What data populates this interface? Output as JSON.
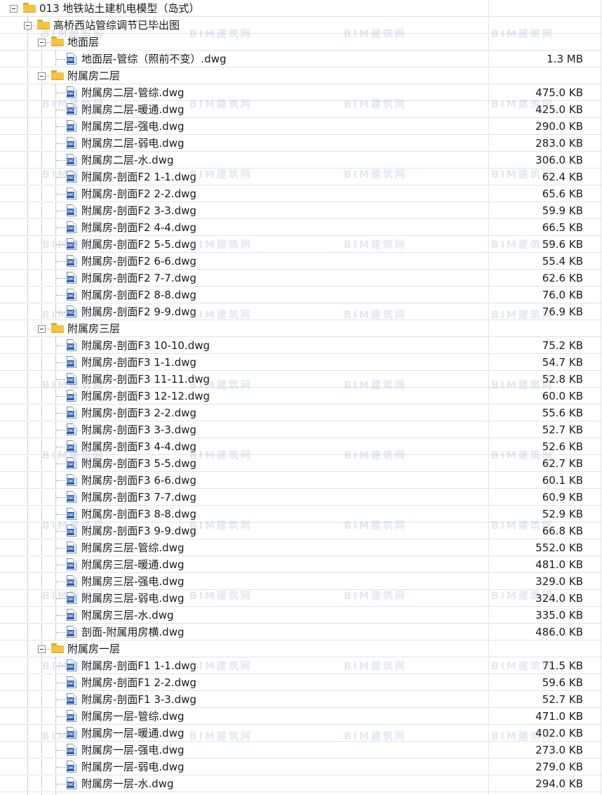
{
  "watermark": "BIM建筑网",
  "rows": [
    {
      "type": "folder",
      "level": 0,
      "label": "013 地铁站土建机电模型（岛式）",
      "size": ""
    },
    {
      "type": "folder",
      "level": 1,
      "label": "高桥西站管综调节已毕出图",
      "size": ""
    },
    {
      "type": "folder",
      "level": 2,
      "label": "地面层",
      "size": ""
    },
    {
      "type": "file",
      "level": 3,
      "label": "地面层-管综（照前不变）.dwg",
      "size": "1.3 MB"
    },
    {
      "type": "folder",
      "level": 2,
      "label": "附属房二层",
      "size": ""
    },
    {
      "type": "file",
      "level": 3,
      "label": "附属房二层-管综.dwg",
      "size": "475.0 KB"
    },
    {
      "type": "file",
      "level": 3,
      "label": "附属房二层-暖通.dwg",
      "size": "425.0 KB"
    },
    {
      "type": "file",
      "level": 3,
      "label": "附属房二层-强电.dwg",
      "size": "290.0 KB"
    },
    {
      "type": "file",
      "level": 3,
      "label": "附属房二层-弱电.dwg",
      "size": "283.0 KB"
    },
    {
      "type": "file",
      "level": 3,
      "label": "附属房二层-水.dwg",
      "size": "306.0 KB"
    },
    {
      "type": "file",
      "level": 3,
      "label": "附属房-剖面F2 1-1.dwg",
      "size": "62.4 KB"
    },
    {
      "type": "file",
      "level": 3,
      "label": "附属房-剖面F2 2-2.dwg",
      "size": "65.6 KB"
    },
    {
      "type": "file",
      "level": 3,
      "label": "附属房-剖面F2 3-3.dwg",
      "size": "59.9 KB"
    },
    {
      "type": "file",
      "level": 3,
      "label": "附属房-剖面F2 4-4.dwg",
      "size": "66.5 KB"
    },
    {
      "type": "file",
      "level": 3,
      "label": "附属房-剖面F2 5-5.dwg",
      "size": "59.6 KB"
    },
    {
      "type": "file",
      "level": 3,
      "label": "附属房-剖面F2 6-6.dwg",
      "size": "55.4 KB"
    },
    {
      "type": "file",
      "level": 3,
      "label": "附属房-剖面F2 7-7.dwg",
      "size": "62.6 KB"
    },
    {
      "type": "file",
      "level": 3,
      "label": "附属房-剖面F2 8-8.dwg",
      "size": "76.0 KB"
    },
    {
      "type": "file",
      "level": 3,
      "label": "附属房-剖面F2 9-9.dwg",
      "size": "76.9 KB"
    },
    {
      "type": "folder",
      "level": 2,
      "label": "附属房三层",
      "size": ""
    },
    {
      "type": "file",
      "level": 3,
      "label": "附属房-剖面F3 10-10.dwg",
      "size": "75.2 KB"
    },
    {
      "type": "file",
      "level": 3,
      "label": "附属房-剖面F3 1-1.dwg",
      "size": "54.7 KB"
    },
    {
      "type": "file",
      "level": 3,
      "label": "附属房-剖面F3 11-11.dwg",
      "size": "52.8 KB"
    },
    {
      "type": "file",
      "level": 3,
      "label": "附属房-剖面F3 12-12.dwg",
      "size": "60.0 KB"
    },
    {
      "type": "file",
      "level": 3,
      "label": "附属房-剖面F3 2-2.dwg",
      "size": "55.6 KB"
    },
    {
      "type": "file",
      "level": 3,
      "label": "附属房-剖面F3 3-3.dwg",
      "size": "52.7 KB"
    },
    {
      "type": "file",
      "level": 3,
      "label": "附属房-剖面F3 4-4.dwg",
      "size": "52.6 KB"
    },
    {
      "type": "file",
      "level": 3,
      "label": "附属房-剖面F3 5-5.dwg",
      "size": "62.7 KB"
    },
    {
      "type": "file",
      "level": 3,
      "label": "附属房-剖面F3 6-6.dwg",
      "size": "60.1 KB"
    },
    {
      "type": "file",
      "level": 3,
      "label": "附属房-剖面F3 7-7.dwg",
      "size": "60.9 KB"
    },
    {
      "type": "file",
      "level": 3,
      "label": "附属房-剖面F3 8-8.dwg",
      "size": "52.9 KB"
    },
    {
      "type": "file",
      "level": 3,
      "label": "附属房-剖面F3 9-9.dwg",
      "size": "66.8 KB"
    },
    {
      "type": "file",
      "level": 3,
      "label": "附属房三层-管综.dwg",
      "size": "552.0 KB"
    },
    {
      "type": "file",
      "level": 3,
      "label": "附属房三层-暖通.dwg",
      "size": "481.0 KB"
    },
    {
      "type": "file",
      "level": 3,
      "label": "附属房三层-强电.dwg",
      "size": "329.0 KB"
    },
    {
      "type": "file",
      "level": 3,
      "label": "附属房三层-弱电.dwg",
      "size": "324.0 KB"
    },
    {
      "type": "file",
      "level": 3,
      "label": "附属房三层-水.dwg",
      "size": "335.0 KB"
    },
    {
      "type": "file",
      "level": 3,
      "label": "剖面-附属用房横.dwg",
      "size": "486.0 KB"
    },
    {
      "type": "folder",
      "level": 2,
      "label": "附属房一层",
      "size": ""
    },
    {
      "type": "file",
      "level": 3,
      "label": "附属房-剖面F1 1-1.dwg",
      "size": "71.5 KB"
    },
    {
      "type": "file",
      "level": 3,
      "label": "附属房-剖面F1 2-2.dwg",
      "size": "59.6 KB"
    },
    {
      "type": "file",
      "level": 3,
      "label": "附属房-剖面F1 3-3.dwg",
      "size": "52.7 KB"
    },
    {
      "type": "file",
      "level": 3,
      "label": "附属房一层-管综.dwg",
      "size": "471.0 KB"
    },
    {
      "type": "file",
      "level": 3,
      "label": "附属房一层-暖通.dwg",
      "size": "402.0 KB"
    },
    {
      "type": "file",
      "level": 3,
      "label": "附属房一层-强电.dwg",
      "size": "273.0 KB"
    },
    {
      "type": "file",
      "level": 3,
      "label": "附属房一层-弱电.dwg",
      "size": "279.0 KB"
    },
    {
      "type": "file",
      "level": 3,
      "label": "附属房一层-水.dwg",
      "size": "294.0 KB"
    }
  ]
}
